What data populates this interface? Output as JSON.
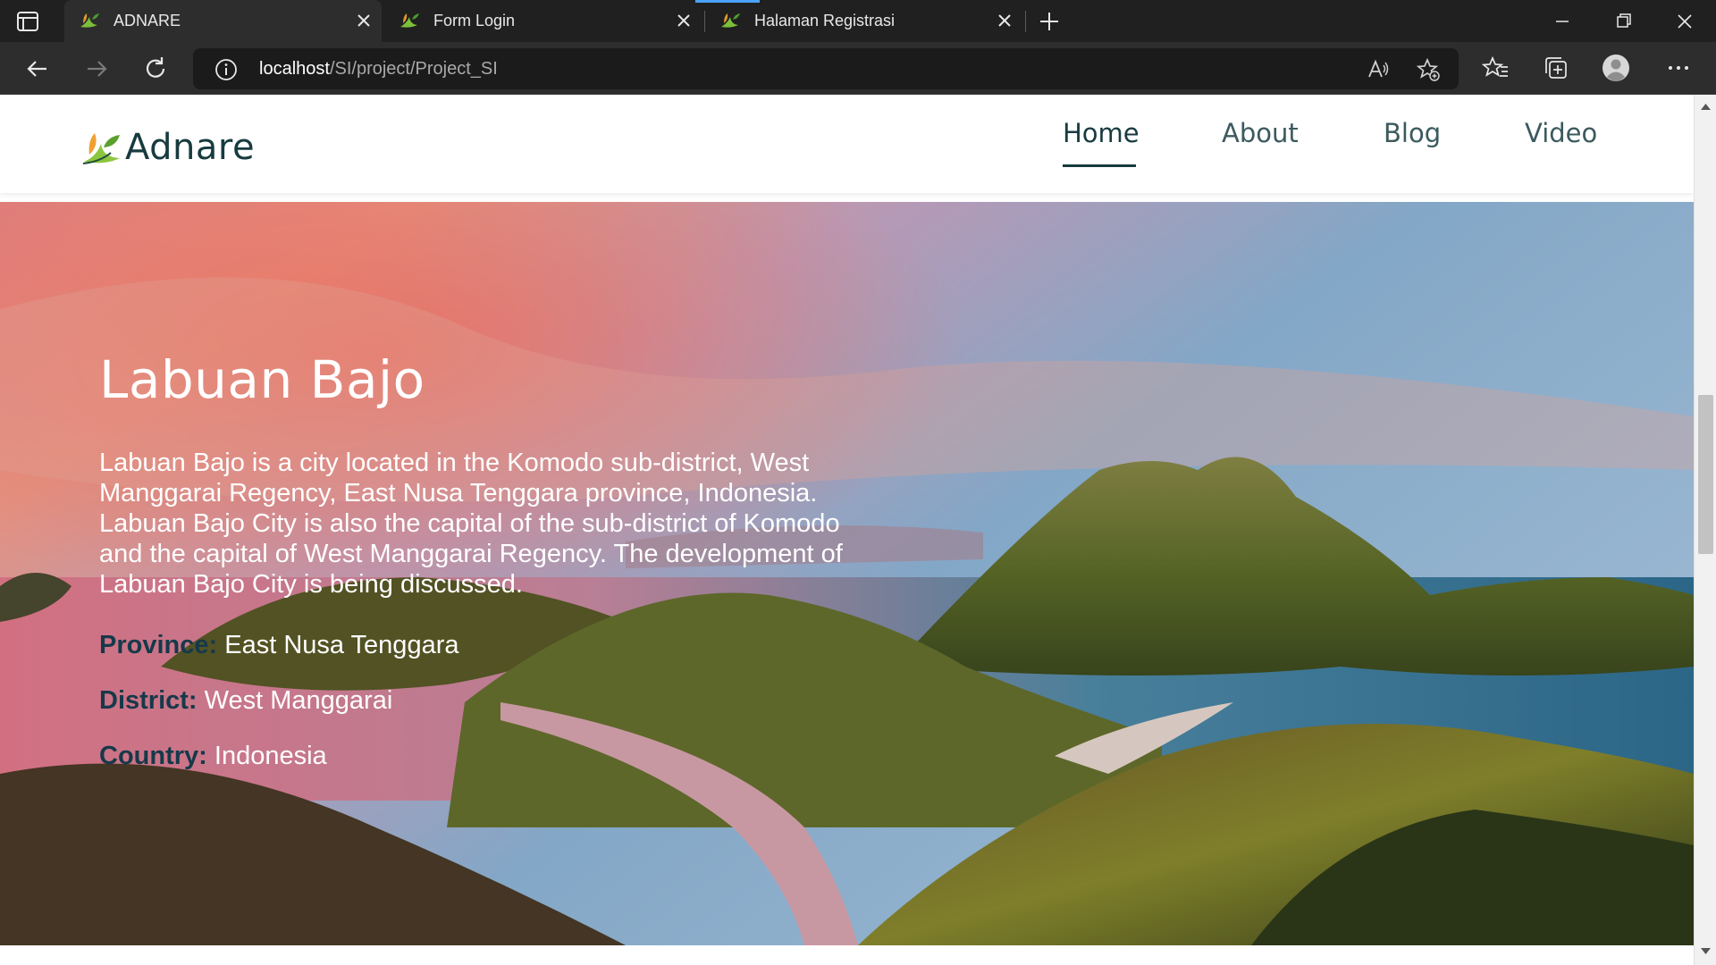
{
  "browser": {
    "tabs": [
      {
        "title": "ADNARE",
        "active": true
      },
      {
        "title": "Form Login",
        "active": false
      },
      {
        "title": "Halaman Registrasi",
        "active": false
      }
    ],
    "address": {
      "host": "localhost",
      "path": "/SI/project/Project_SI"
    },
    "icons": [
      "tab-actions-icon",
      "favicon-leaf-icon",
      "close-icon",
      "plus-icon",
      "minimize-icon",
      "restore-icon",
      "back-arrow-icon",
      "forward-arrow-icon",
      "reload-icon",
      "site-info-icon",
      "read-aloud-icon",
      "add-favorite-icon",
      "favorites-icon",
      "collections-icon",
      "profile-icon",
      "more-icon"
    ]
  },
  "site": {
    "logo": "Adnare",
    "nav": [
      {
        "label": "Home",
        "active": true
      },
      {
        "label": "About",
        "active": false
      },
      {
        "label": "Blog",
        "active": false
      },
      {
        "label": "Video",
        "active": false
      }
    ]
  },
  "hero": {
    "title": "Labuan Bajo",
    "description": "Labuan Bajo is a city located in the Komodo sub-district, West Manggarai Regency, East Nusa Tenggara province, Indonesia. Labuan Bajo City is also the capital of the sub-district of Komodo and the capital of West Manggarai Regency. The development of Labuan Bajo City is being discussed.",
    "province_label": "Province:",
    "province": "East Nusa Tenggara",
    "district_label": "District:",
    "district": "West Manggarai",
    "country_label": "Country:",
    "country": "Indonesia"
  },
  "colors": {
    "brand": "#173b3f",
    "meta_label": "#16394a",
    "chrome_dark": "#202020",
    "chrome_toolbar": "#2d2d2d"
  }
}
